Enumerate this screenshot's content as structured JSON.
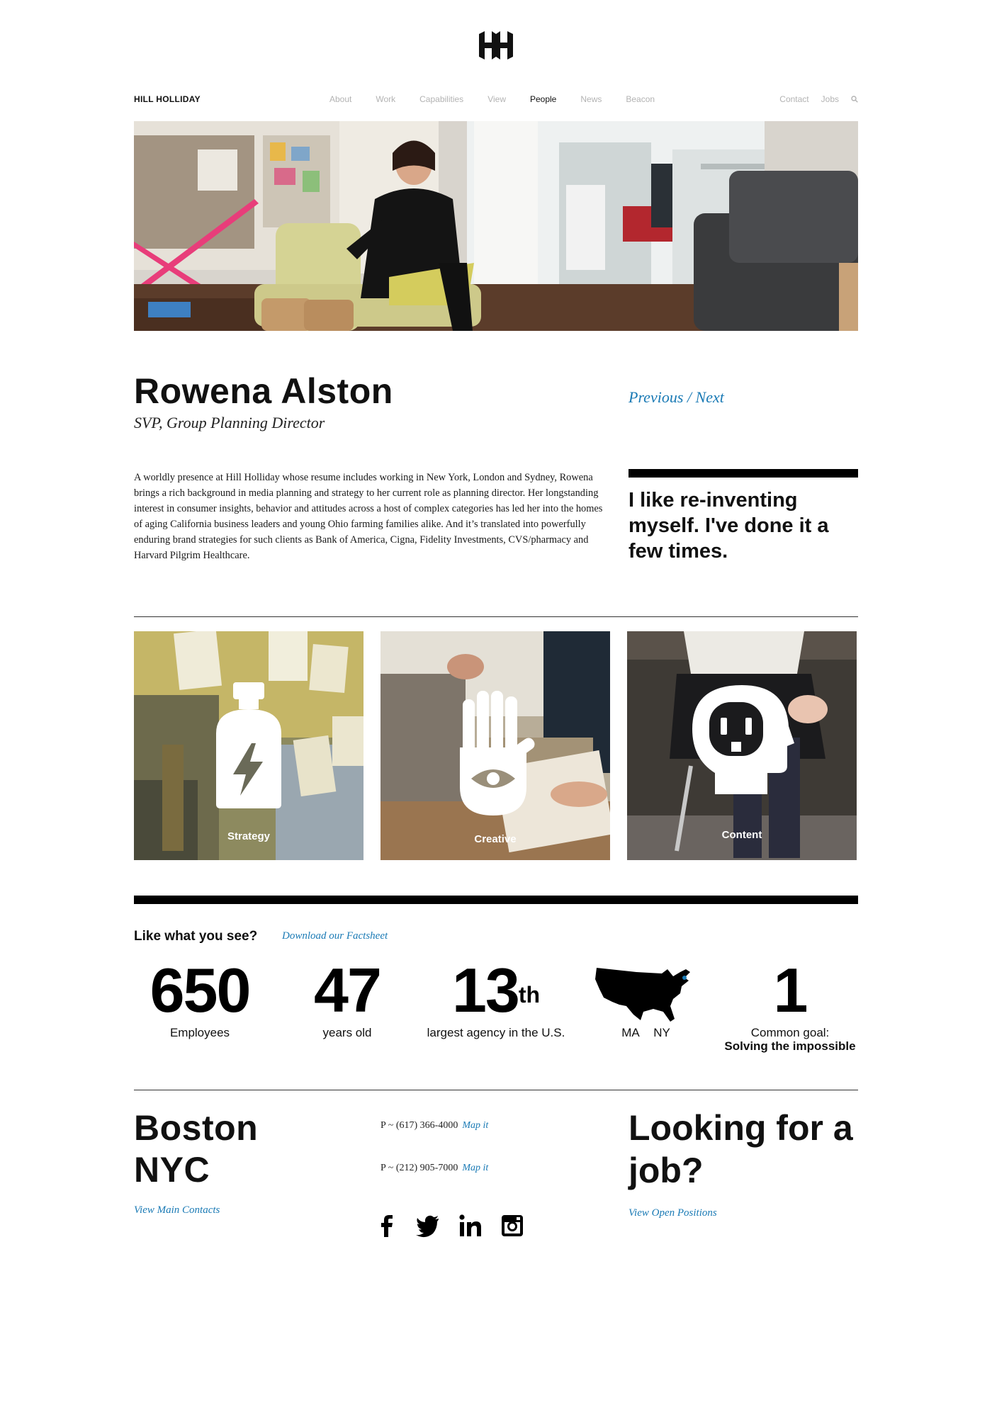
{
  "header": {
    "brand": "HILL HOLLIDAY",
    "nav": [
      "About",
      "Work",
      "Capabilities",
      "View",
      "People",
      "News",
      "Beacon"
    ],
    "active_nav": "People",
    "right_nav": [
      "Contact",
      "Jobs"
    ],
    "search_icon": "search-icon"
  },
  "profile": {
    "name": "Rowena Alston",
    "title": "SVP, Group Planning Director",
    "prev_label": "Previous",
    "separator": " / ",
    "next_label": "Next",
    "bio": "A worldly presence at Hill Holliday whose resume includes working in New York, London and Sydney, Rowena brings a rich background in media planning and strategy to her current role as planning director. Her longstanding interest in consumer insights, behavior and attitudes across a host of complex categories has led her into the homes of aging California business leaders and young Ohio farming families alike. And it’s translated into powerfully enduring brand strategies for such clients as Bank of America, Cigna, Fidelity Investments, CVS/pharmacy and Harvard Pilgrim Healthcare.",
    "quote": "I like re-inventing myself. I've done it a few times."
  },
  "capabilities": [
    {
      "label": "Strategy",
      "icon": "lightning-bottle-icon"
    },
    {
      "label": "Creative",
      "icon": "hand-eye-icon"
    },
    {
      "label": "Content",
      "icon": "outlet-head-icon"
    }
  ],
  "facts": {
    "heading": "Like what you see?",
    "factsheet_link": "Download our Factsheet",
    "employees": {
      "value": "650",
      "label": "Employees"
    },
    "years": {
      "value": "47",
      "label": "years old"
    },
    "rank": {
      "value": "13",
      "suffix": "th",
      "label": "largest agency in the U.S."
    },
    "locations": {
      "icon": "usa-map-icon",
      "labels": [
        "MA",
        "NY"
      ]
    },
    "goal": {
      "value": "1",
      "label": "Common goal:",
      "sub": "Solving the impossible"
    }
  },
  "footer": {
    "cities": [
      "Boston",
      "NYC"
    ],
    "view_contacts": "View Main Contacts",
    "phones": [
      {
        "number": "P ~ (617) 366-4000",
        "map": "Map it"
      },
      {
        "number": "P ~ (212) 905-7000",
        "map": "Map it"
      }
    ],
    "social": [
      "facebook-icon",
      "twitter-icon",
      "linkedin-icon",
      "instagram-icon"
    ],
    "job_heading": "Looking for a job?",
    "view_positions": "View Open Positions"
  },
  "colors": {
    "accent": "#1a7ab5",
    "text": "#111111",
    "nav_inactive": "#b3b3b3"
  }
}
